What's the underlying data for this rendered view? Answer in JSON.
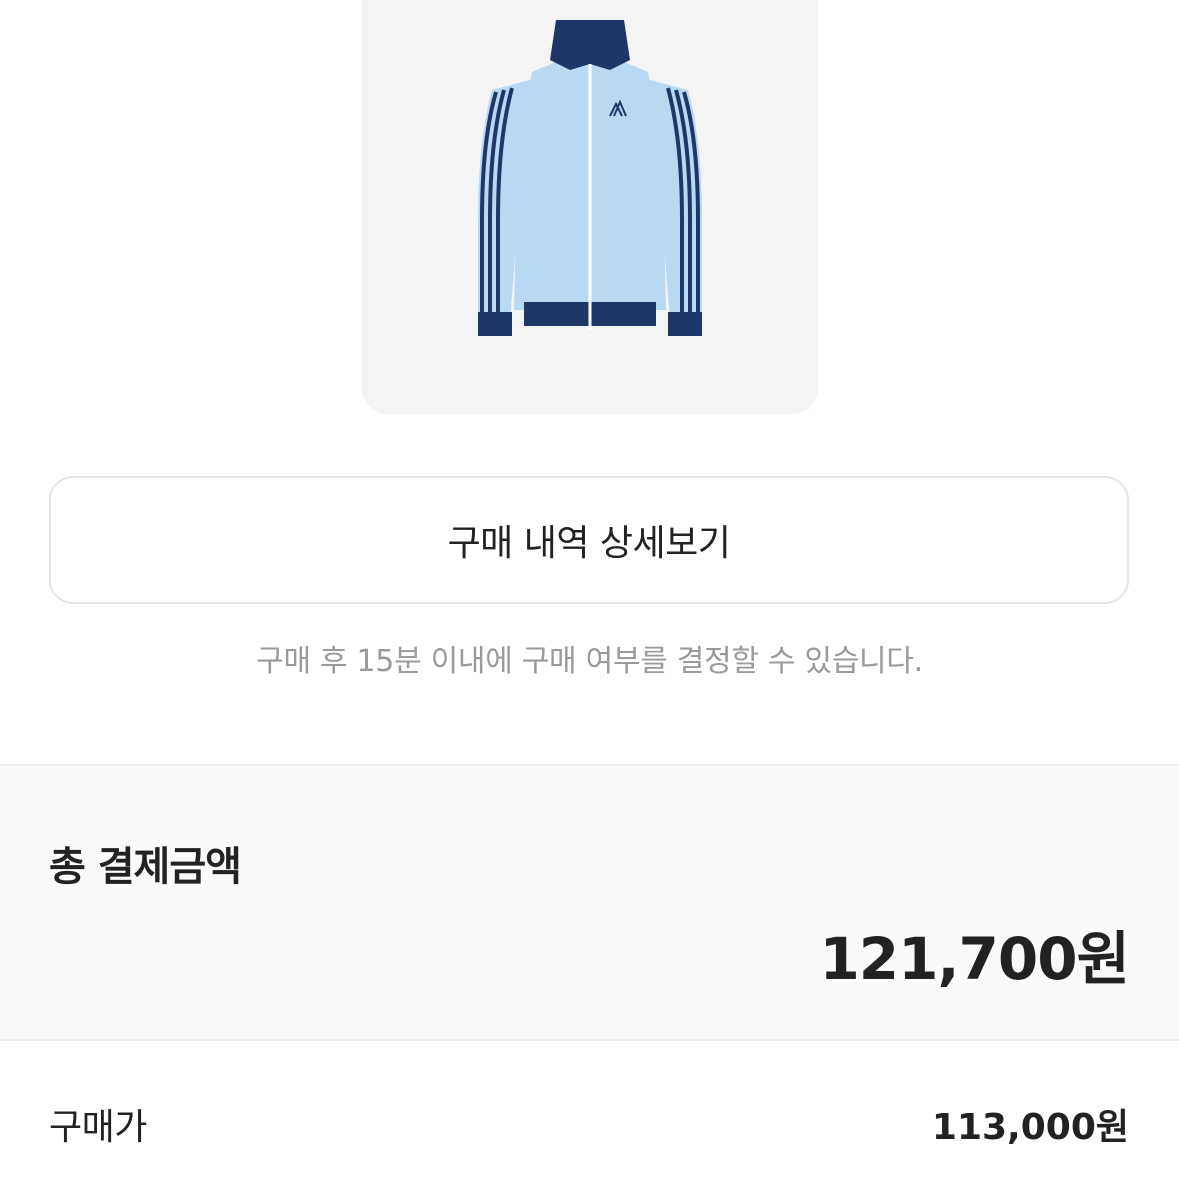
{
  "product": {
    "image_name": "track-jacket-product-image",
    "colors": {
      "body": "#b9d8f1",
      "trim": "#1f3768",
      "stripe": "#ffffff",
      "card_bg": "#f4f4f4"
    }
  },
  "detail_button": {
    "label": "구매 내역 상세보기"
  },
  "notice": {
    "text": "구매 후 15분 이내에 구매 여부를 결정할 수 있습니다."
  },
  "total": {
    "label": "총 결제금액",
    "amount": "121,700원"
  },
  "breakdown": [
    {
      "label": "구매가",
      "value": "113,000원"
    }
  ]
}
